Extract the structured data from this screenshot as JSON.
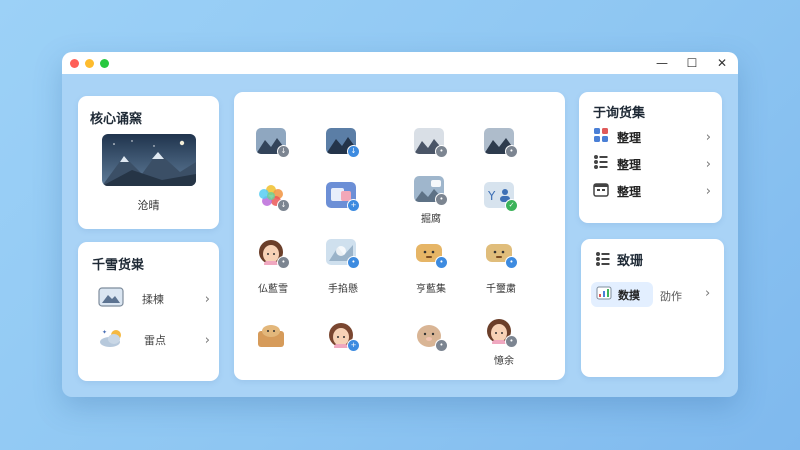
{
  "window": {
    "controls": {
      "minimize": "—",
      "maximize": "☐",
      "close": "✕"
    }
  },
  "core_card": {
    "title": "核心诵窯",
    "image_caption": "沧晴"
  },
  "assets_card": {
    "title": "千雪货粜",
    "items": [
      {
        "label": "揉楝"
      },
      {
        "label": "雷点"
      }
    ]
  },
  "center_grid": {
    "labels": [
      "掘腐",
      "仏藍雪",
      "手掐懸",
      "亨藍集",
      "千璽粛",
      "憶余"
    ]
  },
  "tools_card": {
    "title": "于询货集",
    "items": [
      {
        "label": "整理"
      },
      {
        "label": "整理"
      },
      {
        "label": "整理"
      }
    ]
  },
  "data_card": {
    "title": "致珊",
    "pill_label": "数摸",
    "sub_label": "劭作"
  },
  "colors": {
    "accent": "#3d8be0",
    "background": "#9cd1f7"
  }
}
